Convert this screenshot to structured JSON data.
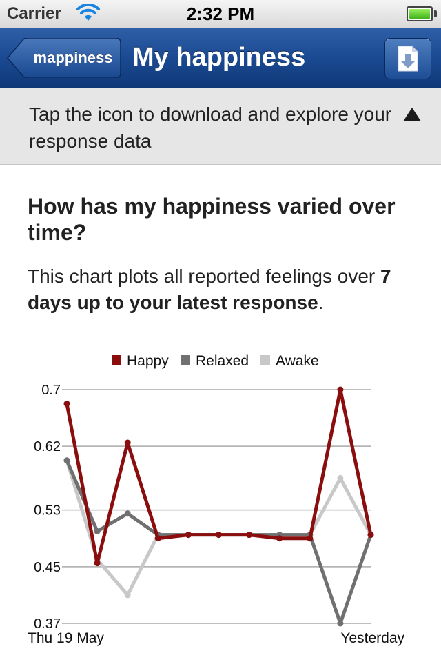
{
  "status_bar": {
    "carrier": "Carrier",
    "time": "2:32 PM",
    "wifi_icon": "wifi-icon",
    "battery_icon": "battery-icon",
    "battery_level": 1.0
  },
  "nav": {
    "back_label": "mappiness",
    "title": "My happiness",
    "download_icon": "download-icon"
  },
  "banner": {
    "text": "Tap the icon to download and explore your response data",
    "toggle_icon": "triangle-up-icon"
  },
  "content": {
    "heading": "How has my happiness varied over time?",
    "desc_prefix": "This chart plots all reported feelings over ",
    "desc_bold": "7 days up to your latest response",
    "desc_suffix": "."
  },
  "chart_data": {
    "type": "line",
    "title": "",
    "xlabel": "",
    "ylabel": "",
    "ylim": [
      0.37,
      0.7
    ],
    "yticks": [
      "0.7",
      "0.62",
      "0.53",
      "0.45",
      "0.37"
    ],
    "ytick_values": [
      0.7,
      0.62,
      0.53,
      0.45,
      0.37
    ],
    "x_start_label": "Thu 19 May",
    "x_end_label": "Yesterday",
    "legend_position": "top-center",
    "grid": true,
    "x": [
      0,
      1,
      2,
      3,
      4,
      5,
      6,
      7,
      8,
      9,
      10
    ],
    "series": [
      {
        "name": "Awake",
        "color": "#c8c8c8",
        "values": [
          0.6,
          0.46,
          0.41,
          0.495,
          0.495,
          0.495,
          0.495,
          0.495,
          0.495,
          0.575,
          0.495
        ]
      },
      {
        "name": "Relaxed",
        "color": "#707070",
        "values": [
          0.6,
          0.5,
          0.525,
          0.495,
          0.495,
          0.495,
          0.495,
          0.495,
          0.495,
          0.37,
          0.495
        ]
      },
      {
        "name": "Happy",
        "color": "#8b0e0e",
        "values": [
          0.68,
          0.455,
          0.625,
          0.49,
          0.495,
          0.495,
          0.495,
          0.49,
          0.49,
          0.7,
          0.495
        ]
      }
    ],
    "legend": [
      "Happy",
      "Relaxed",
      "Awake"
    ]
  }
}
